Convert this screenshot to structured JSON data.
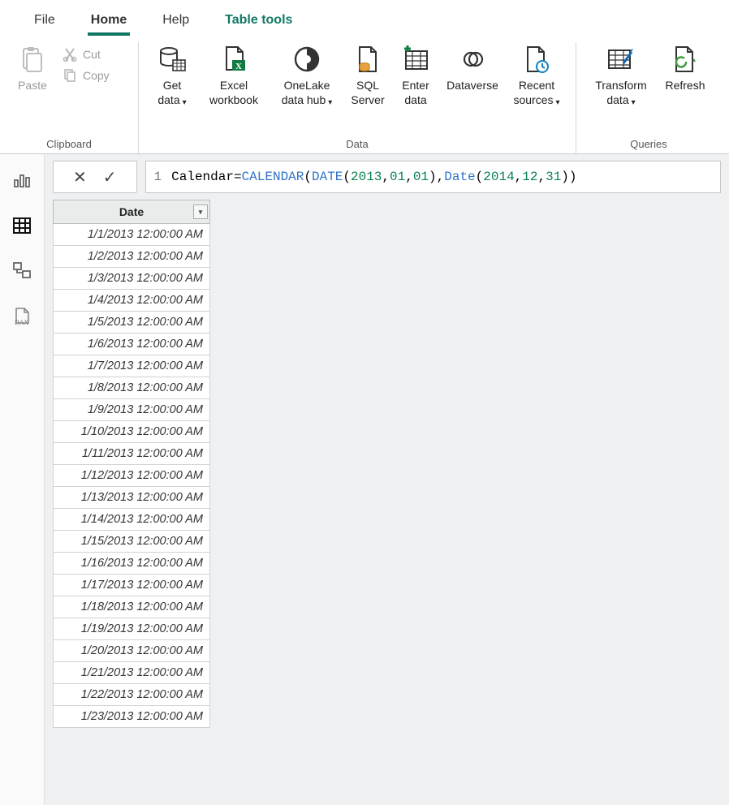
{
  "tabs": {
    "file": "File",
    "home": "Home",
    "help": "Help",
    "table_tools": "Table tools"
  },
  "ribbon": {
    "clipboard": {
      "title": "Clipboard",
      "paste": "Paste",
      "cut": "Cut",
      "copy": "Copy"
    },
    "data": {
      "title": "Data",
      "get_data": "Get data",
      "excel": "Excel workbook",
      "onelake": "OneLake data hub",
      "sql": "SQL Server",
      "enter": "Enter data",
      "dataverse": "Dataverse",
      "recent": "Recent sources"
    },
    "queries": {
      "title": "Queries",
      "transform": "Transform data",
      "refresh": "Refresh"
    }
  },
  "formula": {
    "line_no": "1",
    "identifier": "Calendar",
    "op": " = ",
    "t1": "CALENDAR",
    "p1": "(",
    "t2": "DATE",
    "p2": "(",
    "n1": "2013",
    "c1": ",",
    "n2": "01",
    "c2": ",",
    "n3": "01",
    "p3": ")",
    "c3": ",",
    "t3": "Date",
    "p4": "(",
    "n4": "2014",
    "c4": ",",
    "n5": "12",
    "c5": ",",
    "n6": "31",
    "p5": "))"
  },
  "column_header": "Date",
  "rows": [
    "1/1/2013 12:00:00 AM",
    "1/2/2013 12:00:00 AM",
    "1/3/2013 12:00:00 AM",
    "1/4/2013 12:00:00 AM",
    "1/5/2013 12:00:00 AM",
    "1/6/2013 12:00:00 AM",
    "1/7/2013 12:00:00 AM",
    "1/8/2013 12:00:00 AM",
    "1/9/2013 12:00:00 AM",
    "1/10/2013 12:00:00 AM",
    "1/11/2013 12:00:00 AM",
    "1/12/2013 12:00:00 AM",
    "1/13/2013 12:00:00 AM",
    "1/14/2013 12:00:00 AM",
    "1/15/2013 12:00:00 AM",
    "1/16/2013 12:00:00 AM",
    "1/17/2013 12:00:00 AM",
    "1/18/2013 12:00:00 AM",
    "1/19/2013 12:00:00 AM",
    "1/20/2013 12:00:00 AM",
    "1/21/2013 12:00:00 AM",
    "1/22/2013 12:00:00 AM",
    "1/23/2013 12:00:00 AM"
  ]
}
